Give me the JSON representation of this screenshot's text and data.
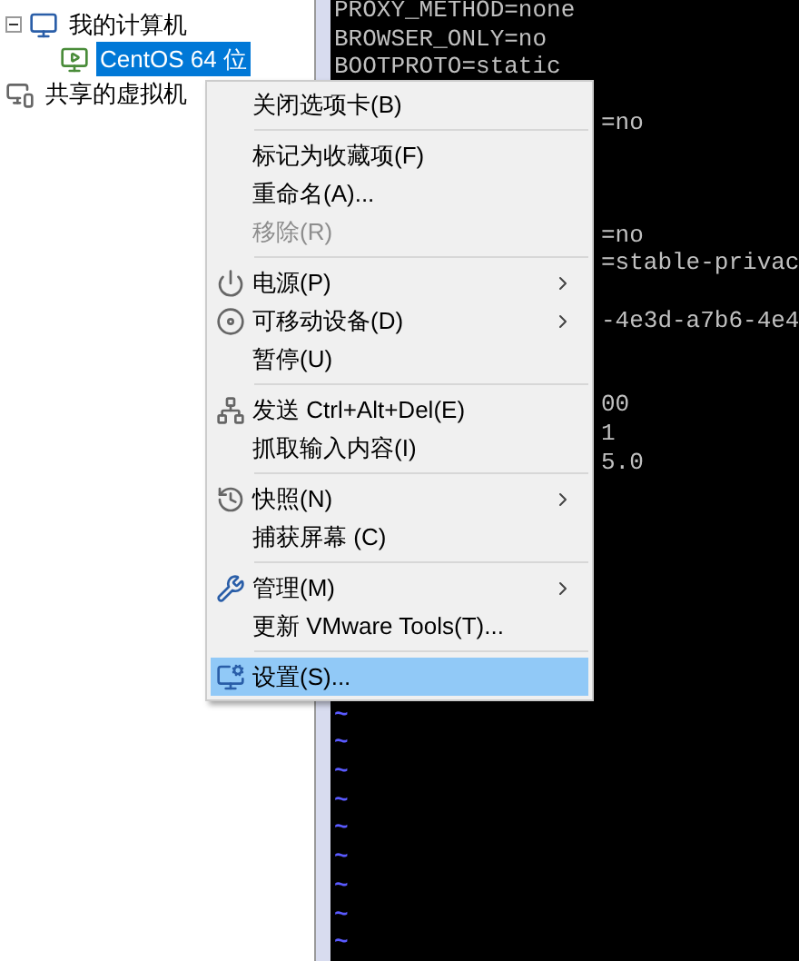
{
  "tree": [
    {
      "label": "我的计算机",
      "expanded": true,
      "selected": false,
      "kind": "computer",
      "children": [
        {
          "label": "CentOS 64 位",
          "selected": true,
          "kind": "vm"
        }
      ]
    },
    {
      "label": "共享的虚拟机",
      "selected": false,
      "kind": "shared"
    }
  ],
  "terminal": [
    {
      "kind": "full",
      "text": "PROXY_METHOD=none"
    },
    {
      "kind": "full",
      "text": "BROWSER_ONLY=no"
    },
    {
      "kind": "full",
      "text": "BOOTPROTO=static"
    },
    {
      "kind": "hidden"
    },
    {
      "kind": "tail",
      "text": "=no"
    },
    {
      "kind": "hidden"
    },
    {
      "kind": "hidden"
    },
    {
      "kind": "hidden"
    },
    {
      "kind": "tail",
      "text": "=no"
    },
    {
      "kind": "tail",
      "text": "=stable-privac"
    },
    {
      "kind": "hidden"
    },
    {
      "kind": "tail",
      "text": "-4e3d-a7b6-4e4"
    },
    {
      "kind": "hidden"
    },
    {
      "kind": "hidden"
    },
    {
      "kind": "tail",
      "text": "00"
    },
    {
      "kind": "tail",
      "text": "1"
    },
    {
      "kind": "tail",
      "text": "5.0"
    },
    {
      "kind": "hidden"
    },
    {
      "kind": "hidden"
    },
    {
      "kind": "hidden"
    },
    {
      "kind": "hidden"
    },
    {
      "kind": "hidden"
    },
    {
      "kind": "hidden"
    },
    {
      "kind": "hidden"
    },
    {
      "kind": "hidden"
    },
    {
      "kind": "tilde",
      "text": "~"
    },
    {
      "kind": "tilde",
      "text": "~"
    },
    {
      "kind": "tilde",
      "text": "~"
    },
    {
      "kind": "tilde",
      "text": "~"
    },
    {
      "kind": "tilde",
      "text": "~"
    },
    {
      "kind": "tilde",
      "text": "~"
    },
    {
      "kind": "tilde",
      "text": "~"
    },
    {
      "kind": "tilde",
      "text": "~"
    },
    {
      "kind": "tilde",
      "text": "~"
    }
  ],
  "context_menu": [
    {
      "kind": "plain",
      "label": "关闭选项卡(B)",
      "disabled": false,
      "submenu": false,
      "selected": false
    },
    {
      "kind": "separator"
    },
    {
      "kind": "plain",
      "label": "标记为收藏项(F)",
      "disabled": false,
      "submenu": false,
      "selected": false
    },
    {
      "kind": "plain",
      "label": "重命名(A)...",
      "disabled": false,
      "submenu": false,
      "selected": false
    },
    {
      "kind": "plain",
      "label": "移除(R)",
      "disabled": true,
      "submenu": false,
      "selected": false
    },
    {
      "kind": "separator"
    },
    {
      "kind": "power",
      "label": "电源(P)",
      "disabled": false,
      "submenu": true,
      "selected": false
    },
    {
      "kind": "disc",
      "label": "可移动设备(D)",
      "disabled": false,
      "submenu": true,
      "selected": false
    },
    {
      "kind": "plain",
      "label": "暂停(U)",
      "disabled": false,
      "submenu": false,
      "selected": false
    },
    {
      "kind": "separator"
    },
    {
      "kind": "send",
      "label": "发送 Ctrl+Alt+Del(E)",
      "disabled": false,
      "submenu": false,
      "selected": false
    },
    {
      "kind": "plain",
      "label": "抓取输入内容(I)",
      "disabled": false,
      "submenu": false,
      "selected": false
    },
    {
      "kind": "separator"
    },
    {
      "kind": "snapshot",
      "label": "快照(N)",
      "disabled": false,
      "submenu": true,
      "selected": false
    },
    {
      "kind": "plain",
      "label": "捕获屏幕 (C)",
      "disabled": false,
      "submenu": false,
      "selected": false
    },
    {
      "kind": "separator"
    },
    {
      "kind": "tools",
      "label": "管理(M)",
      "disabled": false,
      "submenu": true,
      "selected": false
    },
    {
      "kind": "plain",
      "label": "更新 VMware Tools(T)...",
      "disabled": false,
      "submenu": false,
      "selected": false
    },
    {
      "kind": "separator"
    },
    {
      "kind": "settings",
      "label": "设置(S)...",
      "disabled": false,
      "submenu": false,
      "selected": true
    }
  ]
}
